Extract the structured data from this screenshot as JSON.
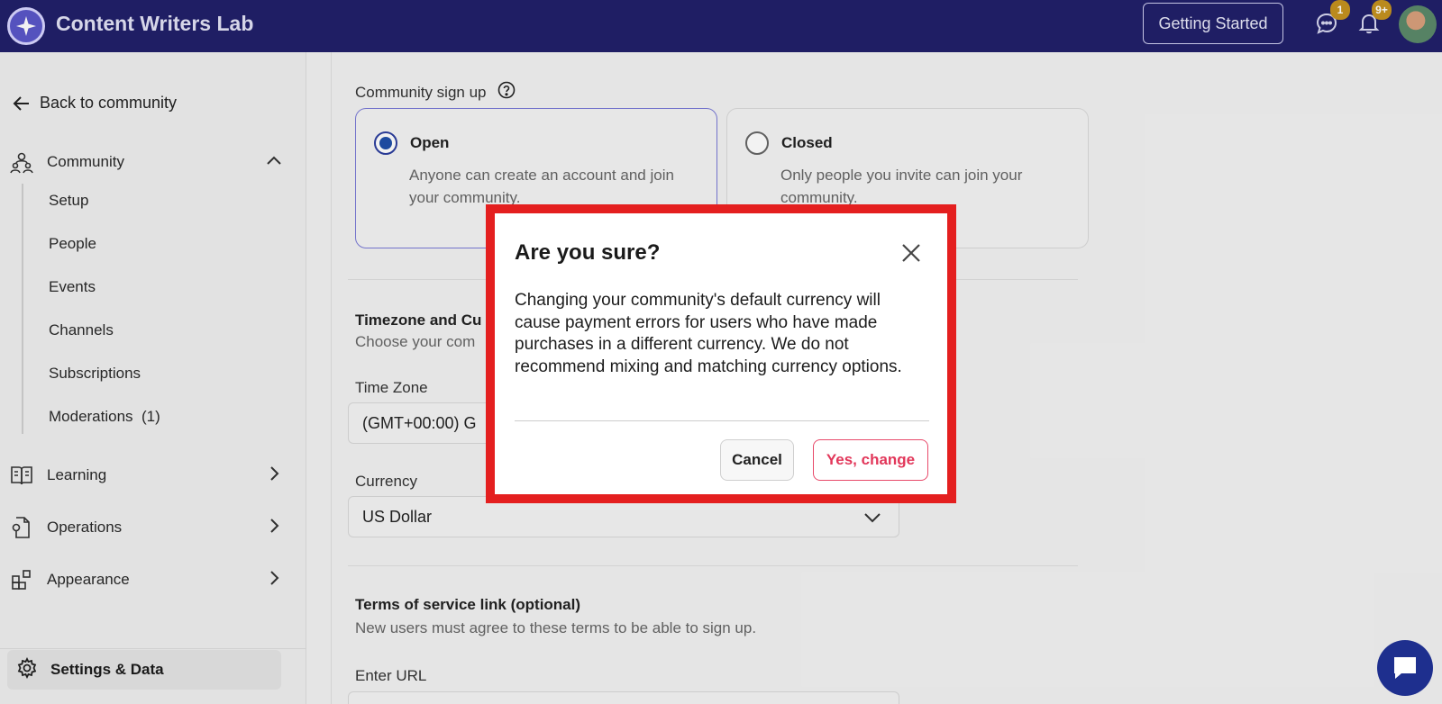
{
  "header": {
    "app_title": "Content Writers Lab",
    "getting_started_label": "Getting Started",
    "messages_badge": "1",
    "notifications_badge": "9+"
  },
  "sidebar": {
    "back_label": "Back to community",
    "sections": [
      {
        "label": "Community",
        "icon": "community-icon",
        "expanded": true
      },
      {
        "label": "Learning",
        "icon": "book-icon",
        "expanded": false
      },
      {
        "label": "Operations",
        "icon": "operations-icon",
        "expanded": false
      },
      {
        "label": "Appearance",
        "icon": "appearance-icon",
        "expanded": false
      }
    ],
    "community_items": [
      "Setup",
      "People",
      "Events",
      "Channels",
      "Subscriptions",
      "Moderations  (1)"
    ],
    "settings_label": "Settings & Data"
  },
  "main": {
    "signup_label": "Community sign up",
    "open_option": {
      "title": "Open",
      "desc": "Anyone can create an account and join your community."
    },
    "closed_option": {
      "title": "Closed",
      "desc": "Only people you invite can join your community."
    },
    "timezone_heading": "Timezone and Cu",
    "timezone_sub": "Choose your com",
    "time_zone_label": "Time Zone",
    "time_zone_value": "(GMT+00:00) G",
    "currency_label": "Currency",
    "currency_value": "US Dollar",
    "terms_heading": "Terms of service link (optional)",
    "terms_sub": "New users must agree to these terms to be able to sign up.",
    "url_label": "Enter URL"
  },
  "modal": {
    "title": "Are you sure?",
    "body": "Changing your community's default currency will cause payment errors for users who have made purchases in a different currency. We do not recommend mixing and matching currency options.",
    "cancel_label": "Cancel",
    "confirm_label": "Yes, change"
  },
  "colors": {
    "header_bg": "#21206a",
    "highlight_border": "#e41f1f",
    "confirm_text": "#e2375a",
    "radio_selected": "#1f4ea8"
  }
}
